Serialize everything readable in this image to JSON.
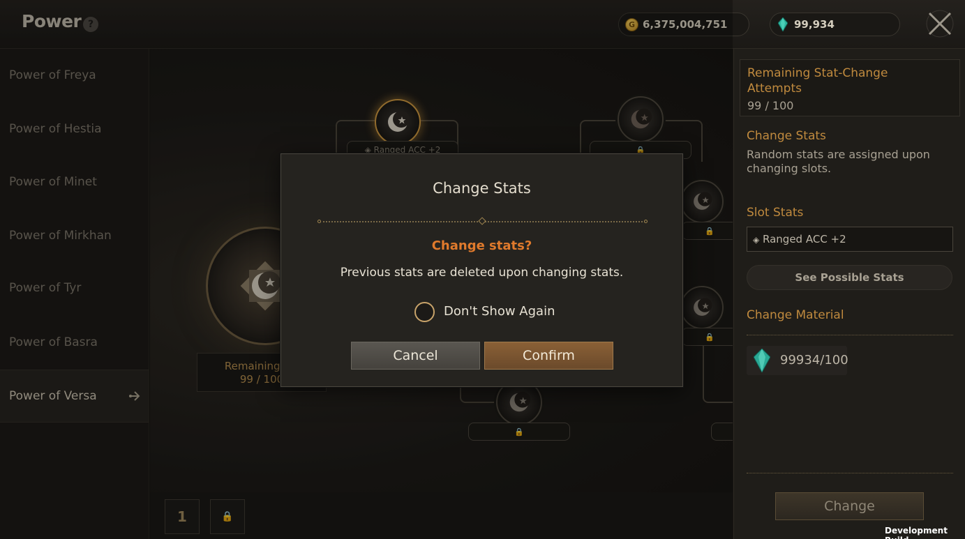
{
  "header": {
    "title": "Power",
    "help_label": "?",
    "gold_amount": "6,375,004,751",
    "gem_amount": "99,934",
    "gold_coin_glyph": "G"
  },
  "sidebar": {
    "items": [
      {
        "label": "Power of Freya",
        "active": false
      },
      {
        "label": "Power of Hestia",
        "active": false
      },
      {
        "label": "Power of Minet",
        "active": false
      },
      {
        "label": "Power of Mirkhan",
        "active": false
      },
      {
        "label": "Power of Tyr",
        "active": false
      },
      {
        "label": "Power of Basra",
        "active": false
      },
      {
        "label": "Power of Versa",
        "active": true
      }
    ]
  },
  "main": {
    "selected_slot_stat": "◈ Ranged ACC +2",
    "remaining_label": "Remaining Att",
    "remaining_value": "99 / 100",
    "lock_glyph": "🔒"
  },
  "pagebar": {
    "page_1": "1",
    "page_2_glyph": "🔒"
  },
  "right_panel": {
    "attempts_title": "Remaining Stat-Change Attempts",
    "attempts_value": "99 / 100",
    "change_stats_title": "Change Stats",
    "change_stats_desc": "Random stats are assigned upon changing slots.",
    "slot_stats_title": "Slot Stats",
    "slot_stat_value": "Ranged ACC +2",
    "see_possible_label": "See Possible Stats",
    "material_title": "Change Material",
    "material_amount": "99934/100",
    "change_button": "Change"
  },
  "modal": {
    "title": "Change Stats",
    "question": "Change stats?",
    "message": "Previous stats are deleted upon changing stats.",
    "checkbox_label": "Don't Show Again",
    "checkbox_checked": false,
    "cancel_label": "Cancel",
    "confirm_label": "Confirm"
  },
  "footer": {
    "dev_build": "Development Build"
  },
  "colors": {
    "accent_gold": "#c08a3e",
    "warning_orange": "#e07a2c",
    "confirm_brown": "#8a6036"
  }
}
